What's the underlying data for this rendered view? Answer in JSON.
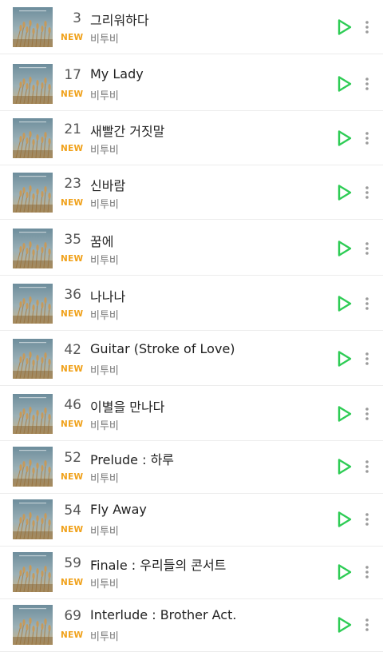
{
  "colors": {
    "new_badge": "#f0a11a",
    "play_icon": "#2ecc55"
  },
  "songs": [
    {
      "rank": "3",
      "badge": "NEW",
      "title": "그리워하다",
      "artist": "비투비"
    },
    {
      "rank": "17",
      "badge": "NEW",
      "title": "My Lady",
      "artist": "비투비"
    },
    {
      "rank": "21",
      "badge": "NEW",
      "title": "새빨간 거짓말",
      "artist": "비투비"
    },
    {
      "rank": "23",
      "badge": "NEW",
      "title": "신바람",
      "artist": "비투비"
    },
    {
      "rank": "35",
      "badge": "NEW",
      "title": "꿈에",
      "artist": "비투비"
    },
    {
      "rank": "36",
      "badge": "NEW",
      "title": "나나나",
      "artist": "비투비"
    },
    {
      "rank": "42",
      "badge": "NEW",
      "title": "Guitar (Stroke of Love)",
      "artist": "비투비"
    },
    {
      "rank": "46",
      "badge": "NEW",
      "title": "이별을 만나다",
      "artist": "비투비"
    },
    {
      "rank": "52",
      "badge": "NEW",
      "title": "Prelude : 하루",
      "artist": "비투비"
    },
    {
      "rank": "54",
      "badge": "NEW",
      "title": "Fly Away",
      "artist": "비투비"
    },
    {
      "rank": "59",
      "badge": "NEW",
      "title": "Finale : 우리들의 콘서트",
      "artist": "비투비"
    },
    {
      "rank": "69",
      "badge": "NEW",
      "title": "Interlude : Brother Act.",
      "artist": "비투비"
    }
  ]
}
